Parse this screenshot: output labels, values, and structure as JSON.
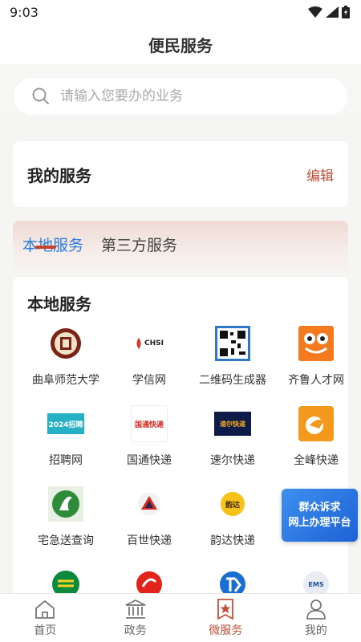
{
  "status": {
    "time": "9:03"
  },
  "header": {
    "title": "便民服务"
  },
  "search": {
    "placeholder": "请输入您要办的业务"
  },
  "my_services": {
    "title": "我的服务",
    "edit_label": "编辑"
  },
  "tabs": [
    {
      "label": "本地服务",
      "active": true
    },
    {
      "label": "第三方服务",
      "active": false
    }
  ],
  "local_services": {
    "title": "本地服务",
    "items": [
      {
        "label": "曲阜师范大学",
        "icon": "university-seal-icon"
      },
      {
        "label": "学信网",
        "icon": "chsi-logo-icon",
        "icon_text": "CHSI"
      },
      {
        "label": "二维码生成器",
        "icon": "qr-code-icon"
      },
      {
        "label": "齐鲁人才网",
        "icon": "frog-logo-icon"
      },
      {
        "label": "招聘网",
        "icon": "recruit-logo-icon",
        "icon_text": "2024招聘"
      },
      {
        "label": "国通快递",
        "icon": "guotong-logo-icon",
        "icon_text": "国通快递"
      },
      {
        "label": "速尔快递",
        "icon": "suer-logo-icon",
        "icon_text": "速尔快递"
      },
      {
        "label": "全峰快递",
        "icon": "quanfeng-logo-icon"
      },
      {
        "label": "宅急送查询",
        "icon": "zjs-logo-icon"
      },
      {
        "label": "百世快递",
        "icon": "best-logo-icon"
      },
      {
        "label": "韵达快递",
        "icon": "yunda-logo-icon",
        "icon_text": "韵达"
      },
      {
        "label": "",
        "icon": "none"
      },
      {
        "label": "",
        "icon": "post-logo-icon"
      },
      {
        "label": "",
        "icon": "red-logo-icon"
      },
      {
        "label": "",
        "icon": "tk-logo-icon"
      },
      {
        "label": "",
        "icon": "ems-logo-icon",
        "icon_text": "EMS"
      }
    ]
  },
  "floating_banner": {
    "line1": "群众诉求",
    "line2": "网上办理平台"
  },
  "bottom_nav": [
    {
      "label": "首页",
      "icon": "home-icon",
      "active": false
    },
    {
      "label": "政务",
      "icon": "government-icon",
      "active": false
    },
    {
      "label": "微服务",
      "icon": "star-badge-icon",
      "active": true
    },
    {
      "label": "我的",
      "icon": "user-icon",
      "active": false
    }
  ],
  "colors": {
    "accent": "#c2503a",
    "tab_active": "#2a7be0",
    "banner": "#2a75e2"
  }
}
